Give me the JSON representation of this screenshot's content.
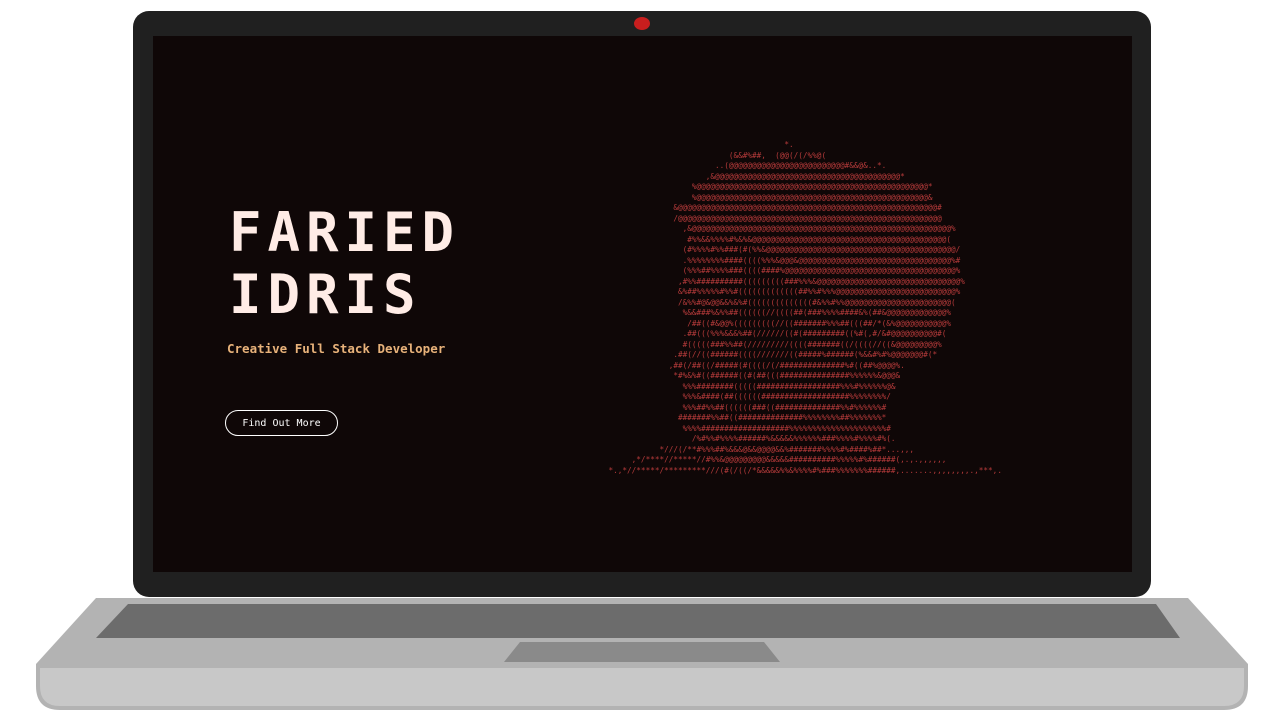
{
  "hero": {
    "name_line1": "FARIED",
    "name_line2": "IDRIS",
    "tagline": "Creative Full Stack Developer",
    "cta_label": "Find Out More"
  },
  "colors": {
    "screen_bg": "#0f0707",
    "name": "#ffece6",
    "tagline": "#e8b27a",
    "ascii": "#b43a3a",
    "camera": "#c81e1e"
  },
  "ascii_portrait": "                                                  *.\n                                      (&&#%##,  (@@(/(/%%@(\n                                   ..(@@@@@@@@@@@@@@@@@@@@@@@@@#&&@&..*.\n                                 ,&@@@@@@@@@@@@@@@@@@@@@@@@@@@@@@@@@@@@@@@@*\n                              %@@@@@@@@@@@@@@@@@@@@@@@@@@@@@@@@@@@@@@@@@@@@@@@@@@*\n                              %@@@@@@@@@@@@@@@@@@@@@@@@@@@@@@@@@@@@@@@@@@@@@@@@@@&\n                          &@@@@@@@@@@@@@@@@@@@@@@@@@@@@@@@@@@@@@@@@@@@@@@@@@@@@@@@@#\n                          /@@@@@@@@@@@@@@@@@@@@@@@@@@@@@@@@@@@@@@@@@@@@@@@@@@@@@@@@@\n                            ,&@@@@@@@@@@@@@@@@@@@@@@@@@@@@@@@@@@@@@@@@@@@@@@@@@@@@@@@@%\n                             #%%&&%%%%#%&%&@@@@@@@@@@@@@@@@@@@@@@@@@@@@@@@@@@@@@@@@@@(\n                            (#%%%%#%%###(#(%%&@@@@@@@@@@@@@@@@@@@@@@@@@@@@@@@@@@@@@@@@@/\n                            .%%%%%%%%####((((%%%&@@@&@@@@@@@@@@@@@@@@@@@@@@@@@@@@@@@@@%#\n                            (%%%##%%%%###((((####%@@@@@@@@@@@@@@@@@@@@@@@@@@@@@@@@@@@@@%\n                           ,#%%##########(((((((((###%%%&@@@@@@@@@@@@@@@@@@@@@@@@@@@@@@@%\n                           &%##%%%%%#%%#(((((((((((((##%%#%%%@@@@@@@@@@@@@@@@@@@@@@@@@@%\n                           /&%%#@&@@&&%&%#((((((((((((((#&%%#%%@@@@@@@@@@@@@@@@@@@@@@@(\n                            %&&###%&%%##((((((//((((##(###%%%%####&%(##&@@@@@@@@@@@@@%\n                             /##((#&@@%(((((((((//((#######%%%##(((##/*(&%@@@@@@@@@@@%\n                            .##(((%%%&&&%##(//////((#(#########((%#(,#/&#@@@@@@@@@@#(\n                            #(((((###%%##(/////////((((#######((/((((//((&@@@@@@@@@%\n                          .##(//((######((((///////((#####%######(%&&#%#%@@@@@@@#(*\n                         ,##(/##((/#####(#((((/(/##############%#((##%@@@@%.\n                          *#%&%#((######((#(##(((###############%%%%%%&@@@&\n                            %%%########(((((##################%%%#%%%%%%@&\n                            %%%&####(##((((((###################%%%%%%%%/\n                            %%%##%%##((((((###((##############%%#%%%%%%#\n                           #######%%##((##############%%%%%%%%##%%%%%%%*\n                            %%%%###################%%%%%%%%%%%%%%%%%%%%%#\n                              /%#%%#%%%%######%&&&&&%%%%%%###%%%%#%%%%#%(.\n                       *///(/**#%%%##%&&&@&&@@@@&&%#######%%%%#%####%##*...,,,\n                 ,*/****//*****//#%%&@@@@@@@@@&&&&&##########%%%%%#%######(,.,.,,,,,,\n            *.,*//*****/*********///(#(/((/*&&&&&%%&%%%%#%###%%%%%%%######,.......,,,,,,,,.,***,."
}
